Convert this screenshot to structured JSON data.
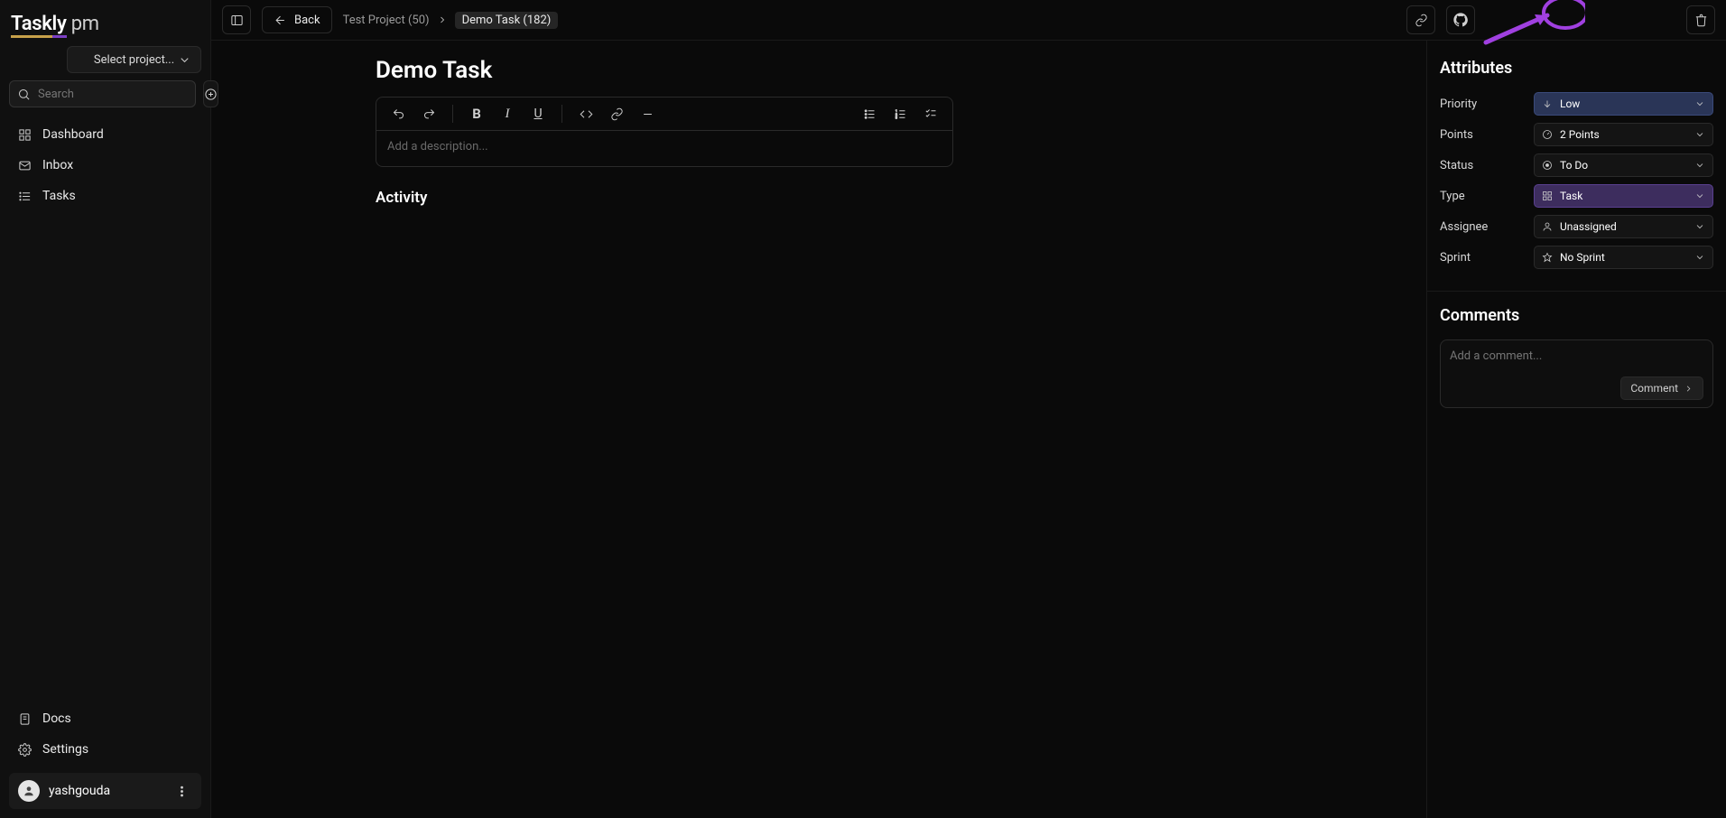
{
  "app": {
    "logo_part1": "Task",
    "logo_part2": "ly",
    "logo_suffix": " pm"
  },
  "sidebar": {
    "project_selector": "Select project...",
    "search_placeholder": "Search",
    "nav": {
      "dashboard": "Dashboard",
      "inbox": "Inbox",
      "tasks": "Tasks",
      "docs": "Docs",
      "settings": "Settings"
    },
    "user": "yashgouda"
  },
  "topbar": {
    "back": "Back",
    "crumb_project": "Test Project (50)",
    "crumb_task": "Demo Task (182)"
  },
  "task": {
    "title": "Demo Task",
    "description_placeholder": "Add a description...",
    "activity_heading": "Activity"
  },
  "attributes": {
    "heading": "Attributes",
    "rows": {
      "priority": {
        "label": "Priority",
        "value": "Low"
      },
      "points": {
        "label": "Points",
        "value": "2 Points"
      },
      "status": {
        "label": "Status",
        "value": "To Do"
      },
      "type": {
        "label": "Type",
        "value": "Task"
      },
      "assignee": {
        "label": "Assignee",
        "value": "Unassigned"
      },
      "sprint": {
        "label": "Sprint",
        "value": "No Sprint"
      }
    }
  },
  "comments": {
    "heading": "Comments",
    "placeholder": "Add a comment...",
    "button": "Comment"
  },
  "colors": {
    "low_bg": "#2a3557",
    "task_bg": "#3d2d5e",
    "annotation": "#a040e0"
  }
}
